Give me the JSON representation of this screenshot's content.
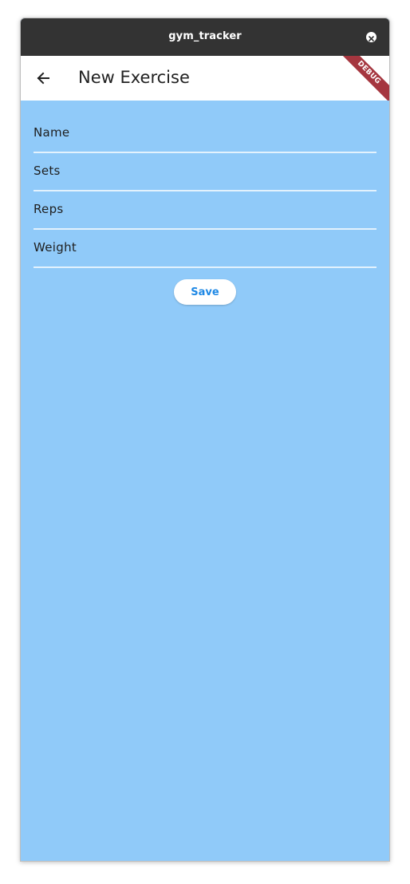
{
  "window": {
    "title": "gym_tracker",
    "close_icon": "close-icon"
  },
  "appbar": {
    "back_icon": "arrow-left-icon",
    "title": "New Exercise",
    "debug_banner": "DEBUG"
  },
  "form": {
    "fields": [
      {
        "label": "Name"
      },
      {
        "label": "Sets"
      },
      {
        "label": "Reps"
      },
      {
        "label": "Weight"
      }
    ],
    "save_label": "Save"
  },
  "colors": {
    "titlebar": "#333333",
    "appbar": "#ffffff",
    "background": "#90caf9",
    "underline": "#e3f2fd",
    "debug_ribbon": "#a5363f",
    "save_text": "#1e88e5"
  }
}
